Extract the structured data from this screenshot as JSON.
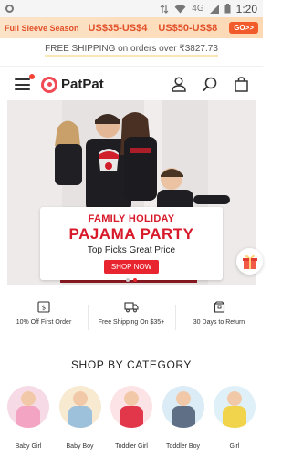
{
  "status_bar": {
    "time": "1:20",
    "network": "4G"
  },
  "promo": {
    "title": "Full Sleeve Season",
    "range1": "US$35-US$4",
    "range2": "US$50-US$8",
    "cta": "GO>>"
  },
  "shipping_notice": "FREE SHIPPING on orders over ₹3827.73",
  "nav": {
    "brand": "PatPat"
  },
  "hero": {
    "line1": "FAMILY HOLIDAY",
    "line2": "PAJAMA PARTY",
    "line3": "Top Picks  Great Price",
    "cta": "SHOP NOW",
    "slides": 2,
    "active_slide": 2
  },
  "benefits": [
    {
      "icon": "coupon-icon",
      "label": "10% Off  First Order"
    },
    {
      "icon": "truck-icon",
      "label": "Free Shipping On $35+"
    },
    {
      "icon": "return-box-icon",
      "label": "30 Days to Return"
    }
  ],
  "category_section": {
    "title": "SHOP BY CATEGORY",
    "items": [
      {
        "label": "Baby Girl",
        "bg": "#f6dbe6",
        "outfit": "#f2a4c2"
      },
      {
        "label": "Baby Boy",
        "bg": "#f7ead0",
        "outfit": "#9dc0db"
      },
      {
        "label": "Toddler Girl",
        "bg": "#fbe3e6",
        "outfit": "#e2374b"
      },
      {
        "label": "Toddler Boy",
        "bg": "#dcecf6",
        "outfit": "#5f6f86"
      },
      {
        "label": "Girl",
        "bg": "#dff0f8",
        "outfit": "#f2d34c"
      }
    ]
  },
  "colors": {
    "brand": "#f04b55",
    "accent": "#e8252f",
    "promo_text": "#e2502a"
  }
}
